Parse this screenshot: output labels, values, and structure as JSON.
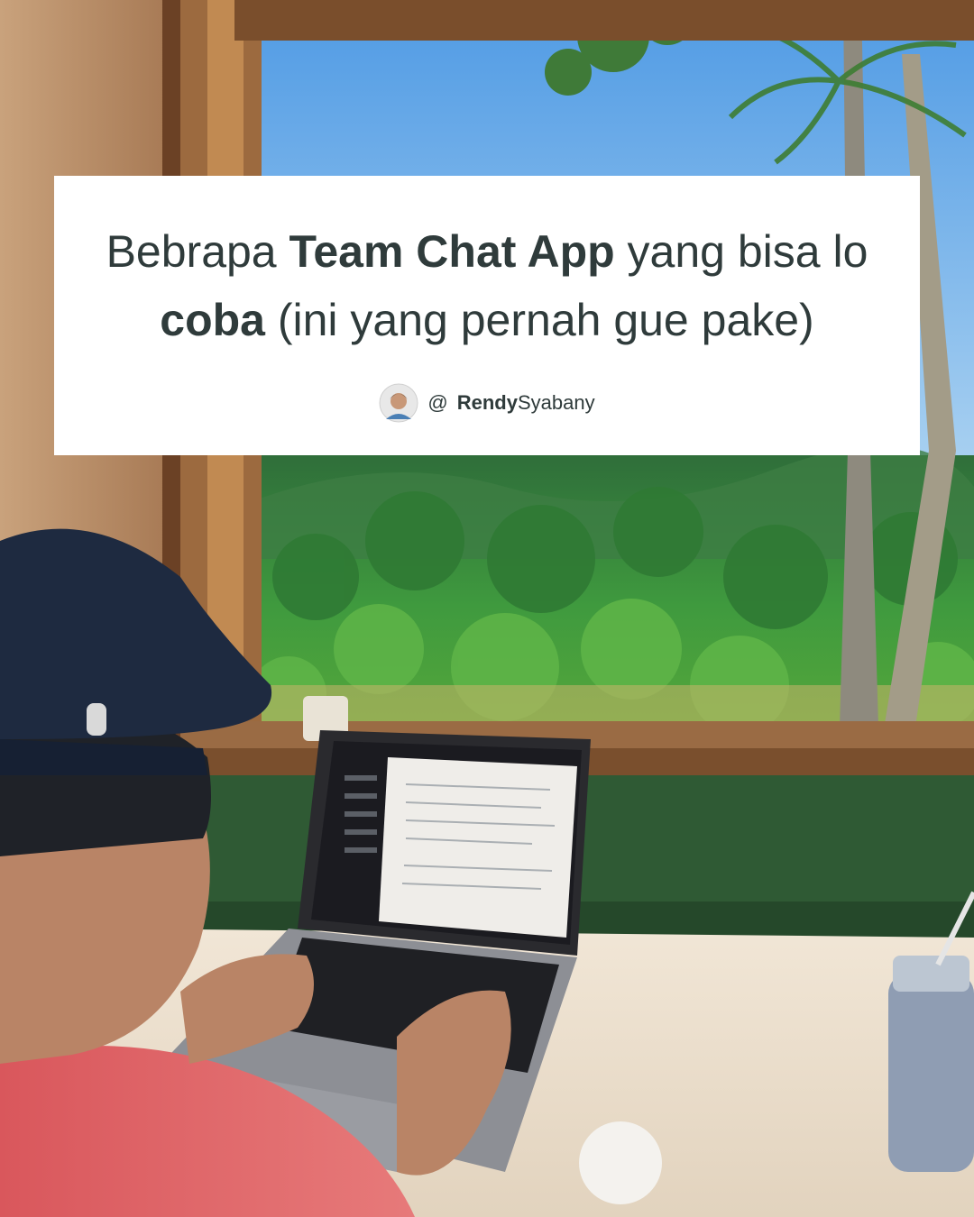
{
  "caption": {
    "title_part1": "Bebrapa ",
    "title_bold1": "Team Chat App",
    "title_part2": " yang bisa lo ",
    "title_bold2": "coba",
    "title_part3": " (ini yang pernah gue pake)",
    "author_at": "@",
    "author_bold": "Rendy",
    "author_rest": "Syabany"
  },
  "colors": {
    "card_background": "#ffffff",
    "text": "#2f3b3b",
    "sky": "#5ea6e6",
    "foliage": "#3f8f3a"
  }
}
